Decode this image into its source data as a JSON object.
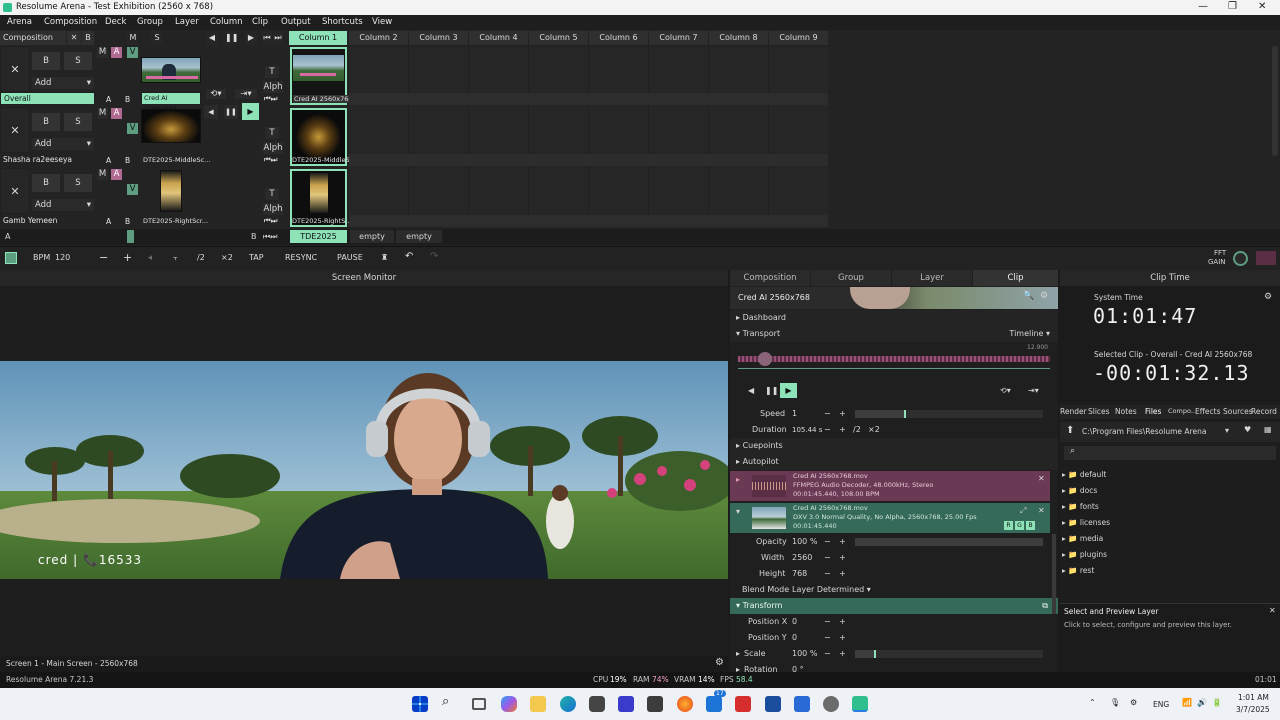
{
  "window": {
    "title": "Resolume Arena - Test Exhibition (2560 x 768)",
    "controls": [
      "—",
      "❐",
      "✕"
    ]
  },
  "menu": [
    "Arena",
    "Composition",
    "Deck",
    "Group",
    "Layer",
    "Column",
    "Clip",
    "Output",
    "Shortcuts",
    "View"
  ],
  "composition": {
    "label": "Composition",
    "x": "✕",
    "b": "B",
    "m": "M",
    "s": "S",
    "columns": [
      "Column 1",
      "Column 2",
      "Column 3",
      "Column 4",
      "Column 5",
      "Column 6",
      "Column 7",
      "Column 8",
      "Column 9"
    ],
    "layers": [
      {
        "name": "Overall",
        "clip_name": "Cred AI 2560x768",
        "cell_clip": "Cred AI 2560x768",
        "add": "Add",
        "a": "A",
        "b": "B",
        "m": "M",
        "s": "S",
        "v": "V",
        "t": "T",
        "alph": "Alph"
      },
      {
        "name": "Shasha ra2eeseya",
        "clip_name": "DTE2025-MiddleSc...",
        "cell_clip": "DTE2025-MiddleS...",
        "add": "Add",
        "a": "A",
        "b": "B",
        "m": "M",
        "s": "S",
        "v": "V",
        "t": "T",
        "alph": "Alph"
      },
      {
        "name": "Gamb Yemeen",
        "clip_name": "DTE2025-RightScr...",
        "cell_clip": "DTE2025-RightS...",
        "add": "Add",
        "a": "A",
        "b": "B",
        "m": "M",
        "s": "S",
        "v": "V",
        "t": "T",
        "alph": "Alph"
      }
    ],
    "footer_a": "A",
    "footer_b": "B",
    "decks": [
      "TDE2025",
      "empty",
      "empty"
    ]
  },
  "toolbar": {
    "bpm_label": "BPM",
    "bpm": "120",
    "minus": "−",
    "plus": "+",
    "half": "/2",
    "double": "×2",
    "tap": "TAP",
    "resync": "RESYNC",
    "pause": "PAUSE",
    "fft": "FFT",
    "gain": "GAIN"
  },
  "monitor": {
    "title": "Screen Monitor",
    "overlay_text": "cred | 📞16533",
    "footer": "Screen 1 - Main Screen - 2560x768"
  },
  "inspector": {
    "tabs": [
      "Composition",
      "Group",
      "Layer",
      "Clip"
    ],
    "clip_name": "Cred AI 2560x768",
    "dashboard": "Dashboard",
    "transport": "Transport",
    "timeline": "Timeline",
    "waveform_time": "12.900",
    "speed_label": "Speed",
    "speed": "1",
    "duration_label": "Duration",
    "duration": "105.44 s",
    "half": "/2",
    "double": "×2",
    "cuepoints": "Cuepoints",
    "autopilot": "Autopilot",
    "audio": {
      "file": "Cred AI 2560x768.mov",
      "codec": "FFMPEG Audio Decoder, 48.000kHz, Stereo",
      "time": "00:01:45.440, 108.00 BPM"
    },
    "video": {
      "file": "Cred AI 2560x768.mov",
      "codec": "DXV 3.0 Normal Quality, No Alpha, 2560x768, 25.00 Fps",
      "time": "00:01:45.440",
      "rgb": [
        "R",
        "G",
        "B"
      ]
    },
    "params": [
      {
        "label": "Opacity",
        "value": "100 %"
      },
      {
        "label": "Width",
        "value": "2560"
      },
      {
        "label": "Height",
        "value": "768"
      }
    ],
    "blend_label": "Blend Mode",
    "blend": "Layer Determined",
    "transform": "Transform",
    "transform_params": [
      {
        "label": "Position X",
        "value": "0"
      },
      {
        "label": "Position Y",
        "value": "0"
      },
      {
        "label": "Scale",
        "value": "100 %"
      },
      {
        "label": "Rotation",
        "value": "0 °"
      }
    ],
    "plus": "+",
    "minus": "−"
  },
  "cliptime": {
    "title": "Clip Time",
    "system_label": "System Time",
    "system_time": "01:01:47",
    "selected_label": "Selected Clip - Overall - Cred AI 2560x768",
    "remaining": "-00:01:32.13"
  },
  "browser": {
    "tabs": [
      "Render",
      "Slices",
      "Notes",
      "Files",
      "Compo...",
      "Effects",
      "Sources",
      "Record"
    ],
    "path": "C:\\Program Files\\Resolume Arena",
    "folders": [
      "default",
      "docs",
      "fonts",
      "licenses",
      "media",
      "plugins",
      "rest"
    ],
    "help_title": "Select and Preview Layer",
    "help_text": "Click to select, configure and preview this layer."
  },
  "status": {
    "app": "Resolume Arena 7.21.3",
    "cpu_label": "CPU",
    "cpu": "19%",
    "ram_label": "RAM",
    "ram": "74%",
    "vram_label": "VRAM",
    "vram": "14%",
    "fps_label": "FPS",
    "fps": "58.4",
    "time": "01:01"
  },
  "taskbar": {
    "lang": "ENG",
    "clock_time": "1:01 AM",
    "clock_date": "3/7/2025",
    "badge": "17"
  },
  "colors": {
    "accent_green": "#8ee2b8",
    "pink": "#b06a92",
    "transform_green": "#35695a"
  }
}
